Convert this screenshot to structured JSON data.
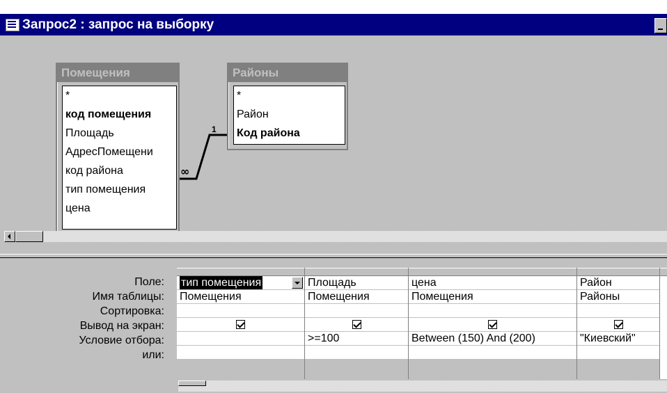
{
  "window": {
    "title": "Запрос2 : запрос на выборку"
  },
  "tables": [
    {
      "name": "Помещения",
      "fields": [
        "*",
        "код помещения",
        "Площадь",
        "АдресПомещени",
        "код района",
        "тип помещения",
        "цена"
      ],
      "bold": [
        1
      ]
    },
    {
      "name": "Районы",
      "fields": [
        "*",
        "Район",
        "Код района"
      ],
      "bold": [
        2
      ]
    }
  ],
  "relationship": {
    "one_label": "1",
    "many_label": "∞"
  },
  "grid": {
    "row_labels": [
      "Поле:",
      "Имя таблицы:",
      "Сортировка:",
      "Вывод на экран:",
      "Условие отбора:",
      "или:"
    ],
    "columns": [
      {
        "field": "тип помещения",
        "table": "Помещения",
        "sort": "",
        "show": true,
        "criteria": "",
        "or": ""
      },
      {
        "field": "Площадь",
        "table": "Помещения",
        "sort": "",
        "show": true,
        "criteria": ">=100",
        "or": ""
      },
      {
        "field": "цена",
        "table": "Помещения",
        "sort": "",
        "show": true,
        "criteria": "Between (150) And (200)",
        "or": ""
      },
      {
        "field": "Район",
        "table": "Районы",
        "sort": "",
        "show": true,
        "criteria": "\"Киевский\"",
        "or": ""
      }
    ]
  }
}
